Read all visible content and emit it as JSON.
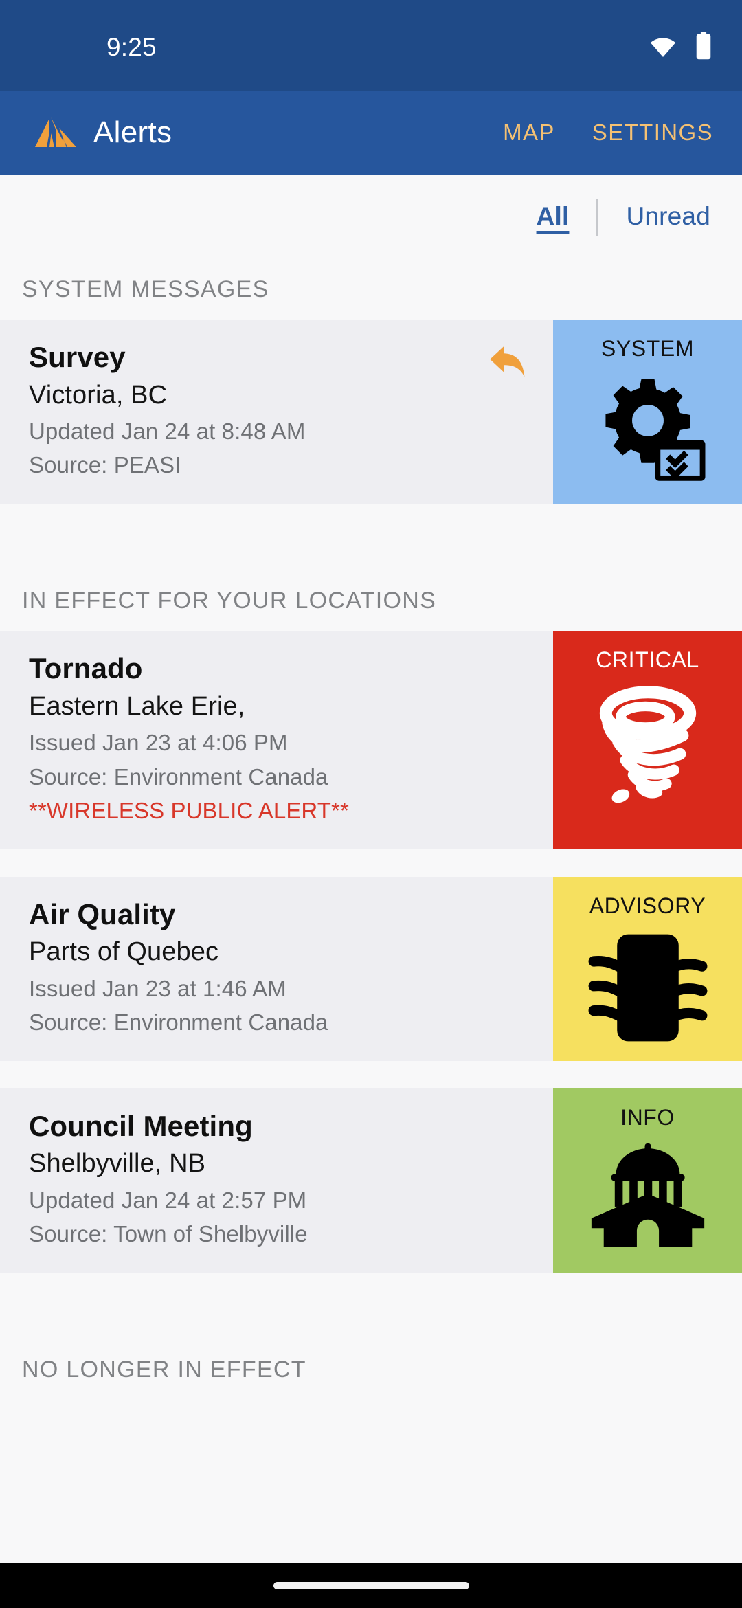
{
  "status_bar": {
    "time": "9:25",
    "wifi_icon": "wifi-icon",
    "battery_icon": "battery-full-icon"
  },
  "app_bar": {
    "logo_icon": "mountain-logo-icon",
    "title": "Alerts",
    "actions": [
      {
        "label": "MAP",
        "name": "map-button"
      },
      {
        "label": "SETTINGS",
        "name": "settings-button"
      }
    ]
  },
  "filters": {
    "all": "All",
    "unread": "Unread",
    "active": "All"
  },
  "sections": [
    {
      "heading": "SYSTEM MESSAGES"
    },
    {
      "heading": "IN EFFECT FOR YOUR LOCATIONS"
    },
    {
      "heading": "NO LONGER IN EFFECT"
    }
  ],
  "alerts": [
    {
      "title": "Survey",
      "location": "Victoria, BC",
      "time": "Updated Jan 24 at 8:48 AM",
      "source": "Source: PEASI",
      "wireless_alert": "",
      "badge_label": "SYSTEM",
      "badge_color": "#8cbcf0",
      "badge_icon": "gear-checklist-icon",
      "has_reply": true,
      "reply_icon": "reply-arrow-icon"
    },
    {
      "title": "Tornado",
      "location": "Eastern Lake Erie,",
      "time": "Issued Jan 23 at 4:06 PM",
      "source": "Source: Environment Canada",
      "wireless_alert": "**WIRELESS PUBLIC ALERT**",
      "badge_label": "CRITICAL",
      "badge_color": "#d9291b",
      "badge_icon": "tornado-icon",
      "has_reply": false,
      "reply_icon": ""
    },
    {
      "title": "Air Quality",
      "location": "Parts of Quebec",
      "time": "Issued Jan 23 at 1:46 AM",
      "source": "Source: Environment Canada",
      "wireless_alert": "",
      "badge_label": "ADVISORY",
      "badge_color": "#f6e05f",
      "badge_icon": "air-quality-waves-icon",
      "has_reply": false,
      "reply_icon": ""
    },
    {
      "title": "Council Meeting",
      "location": "Shelbyville, NB",
      "time": "Updated Jan 24 at 2:57 PM",
      "source": "Source: Town of Shelbyville",
      "wireless_alert": "",
      "badge_label": "INFO",
      "badge_color": "#a1c962",
      "badge_icon": "government-building-icon",
      "has_reply": false,
      "reply_icon": ""
    }
  ],
  "colors": {
    "status_bar": "#1f4a87",
    "app_bar": "#26569d",
    "accent_orange": "#f0a03c",
    "action_text": "#f5c173",
    "link_blue": "#2f5fa4",
    "card_bg": "#eeeef2",
    "page_bg": "#f8f8f9",
    "alert_red": "#d8372a"
  },
  "nav_bar": {
    "gesture_pill": "home-gesture-pill"
  }
}
